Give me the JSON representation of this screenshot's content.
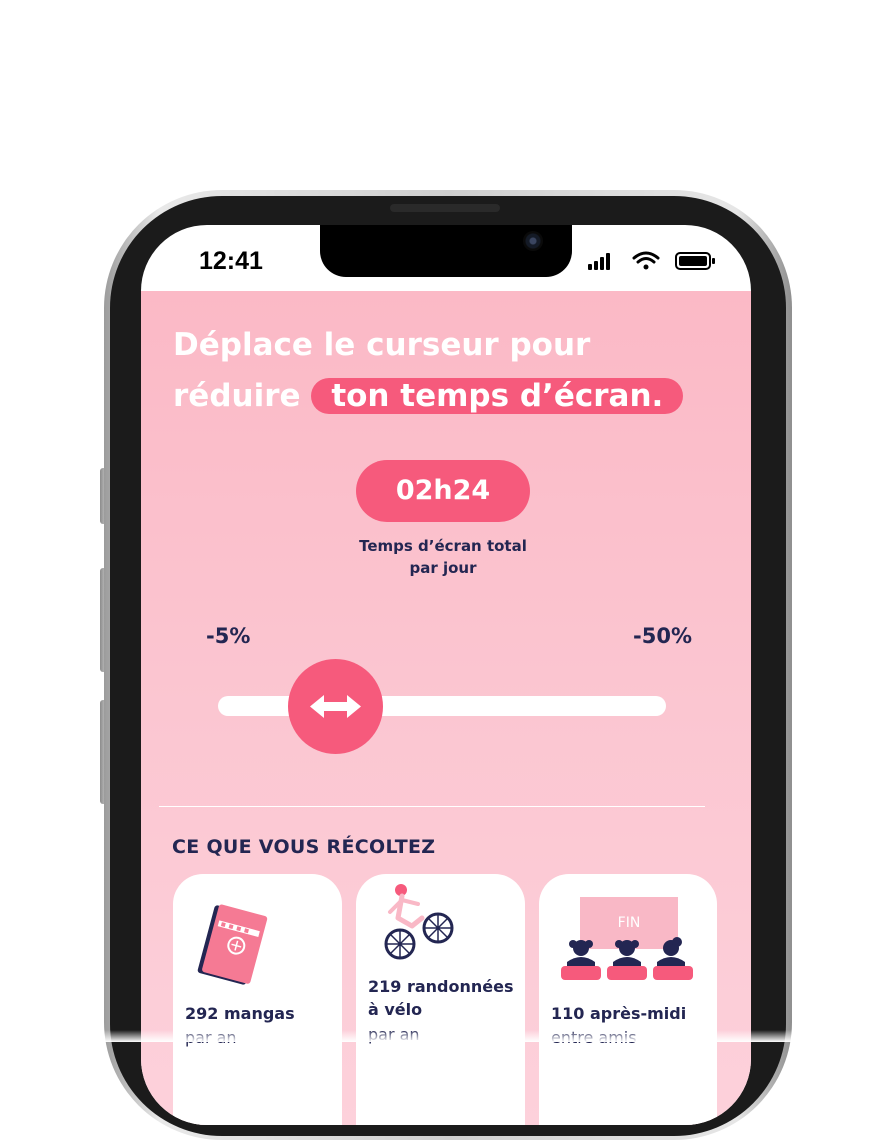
{
  "status_bar": {
    "time": "12:41",
    "icons": [
      "signal-icon",
      "wifi-icon",
      "battery-icon"
    ]
  },
  "headline": {
    "line1": "Déplace le curseur pour",
    "line2_plain": "réduire",
    "line2_highlight": "ton temps d’écran."
  },
  "screen_time": {
    "value": "02h24",
    "caption_line1": "Temps d’écran total",
    "caption_line2": "par jour"
  },
  "slider": {
    "min_label": "-5%",
    "max_label": "-50%",
    "handle_icon": "double-arrow-icon",
    "position_fraction": 0.15
  },
  "section": {
    "title": "CE QUE VOUS RÉCOLTEZ"
  },
  "cards": [
    {
      "icon": "manga-book-icon",
      "title": "292 mangas",
      "subtitle": "par an"
    },
    {
      "icon": "cyclist-icon",
      "title_line1": "219 randonnées",
      "title_line2": "à vélo",
      "subtitle": "par an"
    },
    {
      "icon": "cinema-audience-icon",
      "screen_text": "FIN",
      "title": "110 après-midi",
      "subtitle": "entre amis"
    }
  ],
  "colors": {
    "accent": "#f65a7c",
    "background_top": "#fbb9c6",
    "background_bottom": "#fdd1db",
    "text_dark": "#232652",
    "white": "#ffffff"
  }
}
